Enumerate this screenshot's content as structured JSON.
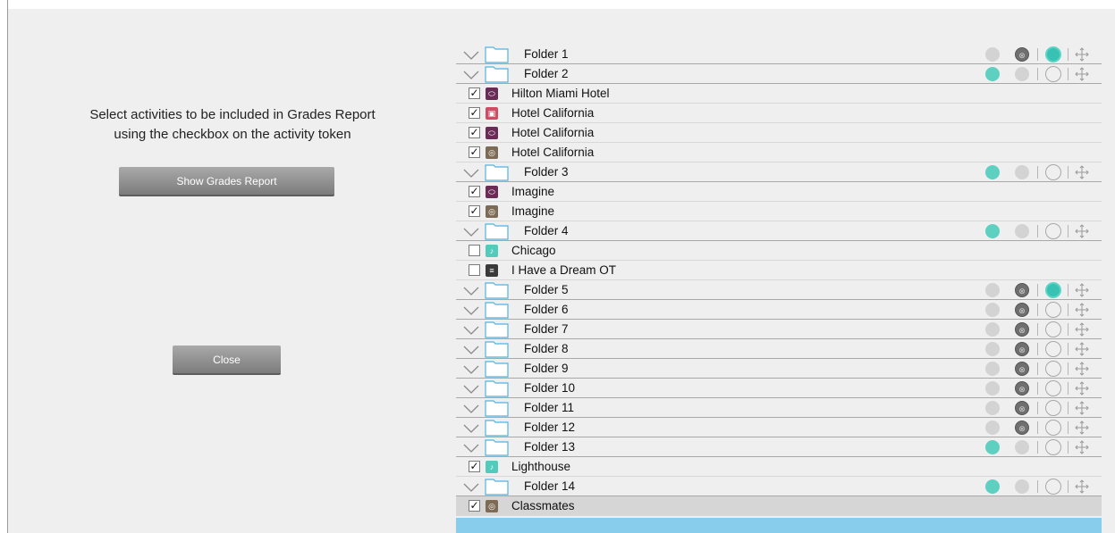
{
  "left": {
    "instruction_line1": "Select activities to be included in Grades Report",
    "instruction_line2": "using the checkbox on the activity token",
    "show_grades_button": "Show Grades Report",
    "close_button": "Close"
  },
  "colors": {
    "accent_teal": "#5ed0c2",
    "selection_blue": "#88cdeb",
    "token_purple": "#6a2b57",
    "token_red": "#d24a63",
    "token_brown": "#7d6b55",
    "token_teal": "#52cbbd",
    "token_dark": "#3a3a3a"
  },
  "rows": [
    {
      "kind": "folder",
      "label": "Folder 1",
      "status1": "grey",
      "status2": "dark",
      "clock": "active"
    },
    {
      "kind": "folder",
      "label": "Folder 2",
      "status1": "green",
      "status2": "grey",
      "clock": "off"
    },
    {
      "kind": "activity",
      "label": "Hilton Miami Hotel",
      "checked": true,
      "token": "chat",
      "token_color": "#6a2b57"
    },
    {
      "kind": "activity",
      "label": "Hotel California",
      "checked": true,
      "token": "video",
      "token_color": "#d24a63"
    },
    {
      "kind": "activity",
      "label": "Hotel California",
      "checked": true,
      "token": "chat",
      "token_color": "#6a2b57"
    },
    {
      "kind": "activity",
      "label": "Hotel California",
      "checked": true,
      "token": "record",
      "token_color": "#7d6b55"
    },
    {
      "kind": "folder",
      "label": "Folder 3",
      "status1": "green",
      "status2": "grey",
      "clock": "off"
    },
    {
      "kind": "activity",
      "label": "Imagine",
      "checked": true,
      "token": "chat",
      "token_color": "#6a2b57"
    },
    {
      "kind": "activity",
      "label": "Imagine",
      "checked": true,
      "token": "record",
      "token_color": "#7d6b55"
    },
    {
      "kind": "folder",
      "label": "Folder 4",
      "status1": "green",
      "status2": "grey",
      "clock": "off"
    },
    {
      "kind": "activity",
      "label": "Chicago",
      "checked": false,
      "token": "audio",
      "token_color": "#52cbbd"
    },
    {
      "kind": "activity",
      "label": "I Have a Dream OT",
      "checked": false,
      "token": "text",
      "token_color": "#3a3a3a"
    },
    {
      "kind": "folder",
      "label": "Folder 5",
      "status1": "grey",
      "status2": "dark",
      "clock": "active"
    },
    {
      "kind": "folder",
      "label": "Folder 6",
      "status1": "grey",
      "status2": "dark",
      "clock": "off"
    },
    {
      "kind": "folder",
      "label": "Folder 7",
      "status1": "grey",
      "status2": "dark",
      "clock": "off"
    },
    {
      "kind": "folder",
      "label": "Folder 8",
      "status1": "grey",
      "status2": "dark",
      "clock": "off"
    },
    {
      "kind": "folder",
      "label": "Folder 9",
      "status1": "grey",
      "status2": "dark",
      "clock": "off"
    },
    {
      "kind": "folder",
      "label": "Folder 10",
      "status1": "grey",
      "status2": "dark",
      "clock": "off"
    },
    {
      "kind": "folder",
      "label": "Folder 11",
      "status1": "grey",
      "status2": "dark",
      "clock": "off"
    },
    {
      "kind": "folder",
      "label": "Folder 12",
      "status1": "grey",
      "status2": "dark",
      "clock": "off"
    },
    {
      "kind": "folder",
      "label": "Folder 13",
      "status1": "green",
      "status2": "grey",
      "clock": "off"
    },
    {
      "kind": "activity",
      "label": "Lighthouse",
      "checked": true,
      "token": "audio",
      "token_color": "#52cbbd"
    },
    {
      "kind": "folder",
      "label": "Folder 14",
      "status1": "green",
      "status2": "grey",
      "clock": "off"
    },
    {
      "kind": "activity",
      "label": "Classmates",
      "checked": true,
      "token": "record",
      "token_color": "#7d6b55",
      "selected": true
    }
  ]
}
